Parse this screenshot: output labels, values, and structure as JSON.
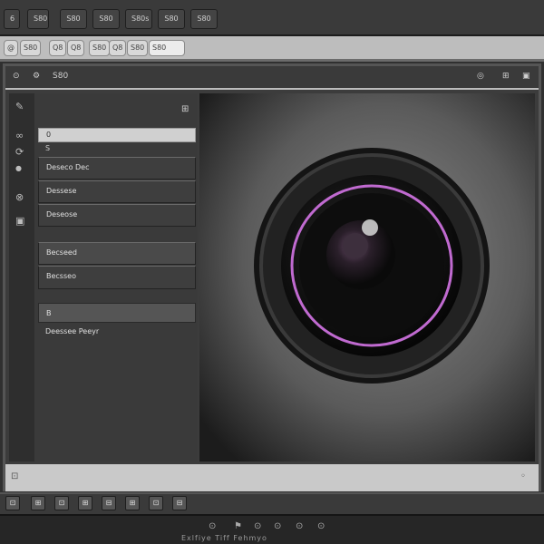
{
  "top_tabs": [
    "6",
    "S80",
    "S80",
    "S80",
    "S80s",
    "S80",
    "S80"
  ],
  "toolbar_chips": [
    "@",
    "S80",
    "Q8",
    "Q8",
    "S80",
    "Q8",
    "S80",
    "S80"
  ],
  "window": {
    "title_icons": [
      "⊙",
      "⚙",
      "S80"
    ],
    "right_icons": [
      "◎",
      "⊞",
      "▣"
    ]
  },
  "left_rail_icons": [
    "✎",
    "∞",
    "⟳",
    "●",
    "⊗",
    "▣"
  ],
  "panel": {
    "header_icon": "⊞",
    "rows": [
      {
        "label": "0",
        "sub": "S"
      },
      {
        "label": "Deseco Dec"
      },
      {
        "label": "Dessese"
      },
      {
        "label": "Deseose"
      },
      {
        "label": "Becseed"
      },
      {
        "label": "Becsseo"
      },
      {
        "label": "B"
      },
      {
        "label": "Deessee Peeyr"
      }
    ]
  },
  "status": {
    "left": "⊡",
    "right": "◦"
  },
  "bottom_buttons": [
    "⊡",
    "⊞",
    "⊡",
    "⊞",
    "⊟",
    "⊞",
    "⊡",
    "⊟"
  ],
  "footer": {
    "icons": [
      "⊙",
      "⚑",
      "⊙",
      "⊙",
      "⊙",
      "⊙"
    ],
    "caption": "Exlfiye Tiff Fehmyo"
  },
  "colors": {
    "lens_ring": "#c06ad0",
    "accent_light": "#e0e0e0"
  }
}
